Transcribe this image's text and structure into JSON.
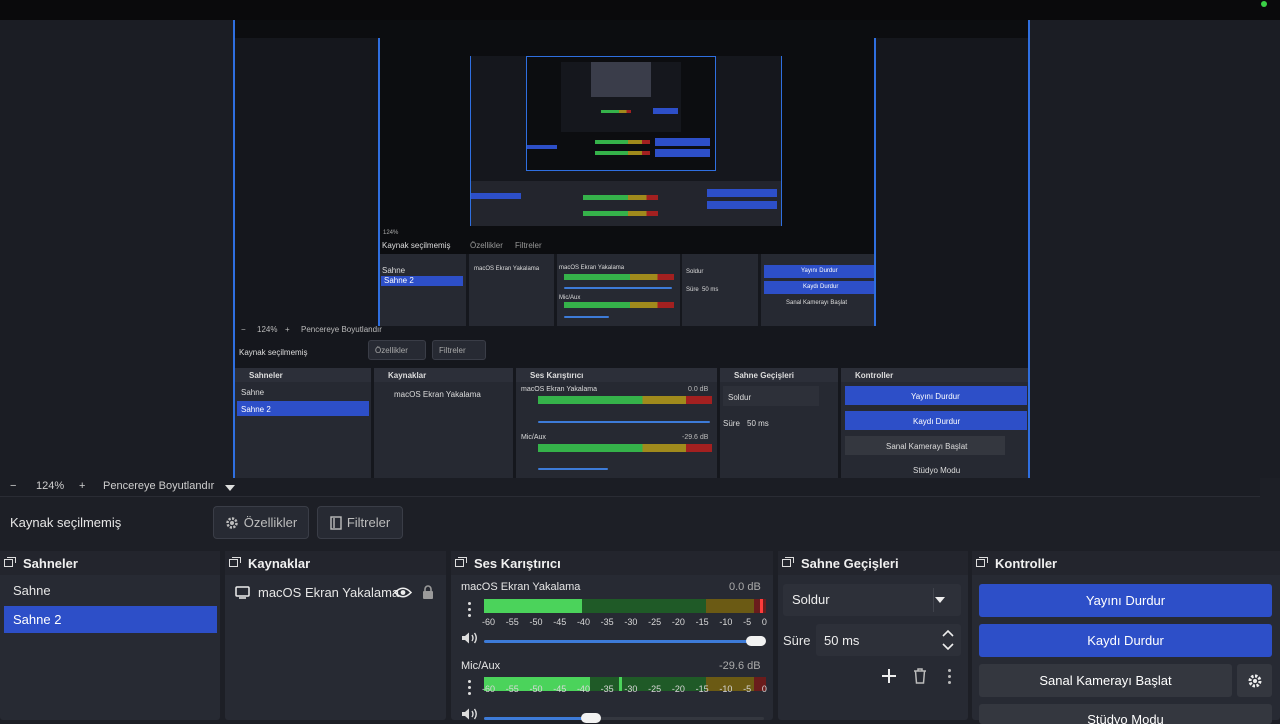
{
  "preview": {
    "nested_source_status": "Kaynak seçilmemiş",
    "nested_properties": "Özellikler",
    "nested_filters": "Filtreler",
    "nested_zoom": "124%",
    "nested_fit": "Pencereye Boyutlandır",
    "nested_scenes": [
      "Sahne",
      "Sahne 2"
    ],
    "nested_source": "macOS Ekran Yakalama",
    "nested_mixer_title": "Ses Karıştırıcı",
    "nested_mixer_ch1": "macOS Ekran Yakalama",
    "nested_mixer_ch1_db": "0.0 dB",
    "nested_mixer_ch2": "Mic/Aux",
    "nested_mixer_ch2_db": "-29.6 dB",
    "nested_transitions_title": "Sahne Geçişleri",
    "nested_transition": "Soldur",
    "nested_duration_label": "Süre",
    "nested_duration": "50 ms",
    "nested_controls_title": "Kontroller",
    "nested_stop_stream": "Yayını Durdur",
    "nested_stop_record": "Kaydı Durdur",
    "nested_virtual_cam": "Sanal Kamerayı Başlat",
    "nested_studio": "Stüdyo Modu"
  },
  "zoom": {
    "minus": "−",
    "value": "124%",
    "plus": "+",
    "fit": "Pencereye Boyutlandır"
  },
  "source_bar": {
    "status": "Kaynak seçilmemiş",
    "properties": "Özellikler",
    "filters": "Filtreler"
  },
  "scenes": {
    "title": "Sahneler",
    "items": [
      {
        "label": "Sahne",
        "selected": false
      },
      {
        "label": "Sahne 2",
        "selected": true
      }
    ]
  },
  "sources": {
    "title": "Kaynaklar",
    "items": [
      {
        "label": "macOS Ekran Yakalama",
        "visible": true,
        "locked": true
      }
    ]
  },
  "mixer": {
    "title": "Ses Karıştırıcı",
    "ticks": [
      "-60",
      "-55",
      "-50",
      "-45",
      "-40",
      "-35",
      "-30",
      "-25",
      "-20",
      "-15",
      "-10",
      "-5",
      "0"
    ],
    "channels": [
      {
        "name": "macOS Ekran Yakalama",
        "db": "0.0 dB",
        "volume": 1.0
      },
      {
        "name": "Mic/Aux",
        "db": "-29.6 dB",
        "volume": 0.38
      }
    ]
  },
  "transitions": {
    "title": "Sahne Geçişleri",
    "selected": "Soldur",
    "duration_label": "Süre",
    "duration": "50 ms"
  },
  "controls": {
    "title": "Kontroller",
    "stop_stream": "Yayını Durdur",
    "stop_record": "Kaydı Durdur",
    "virtual_cam": "Sanal Kamerayı Başlat",
    "studio_mode": "Stüdyo Modu"
  },
  "colors": {
    "accent": "#2d4fc8",
    "background": "#1d1f26",
    "panel": "#272a33",
    "meter_green": "#35b24a",
    "meter_yellow": "#a08a1c",
    "meter_red": "#a32020"
  },
  "icons": [
    "gear-icon",
    "filter-icon",
    "eye-icon",
    "lock-icon",
    "monitor-icon",
    "volume-icon",
    "kebab-icon",
    "plus-icon",
    "trash-icon",
    "chevron-down-icon",
    "chevron-up-icon",
    "dock-icon"
  ]
}
